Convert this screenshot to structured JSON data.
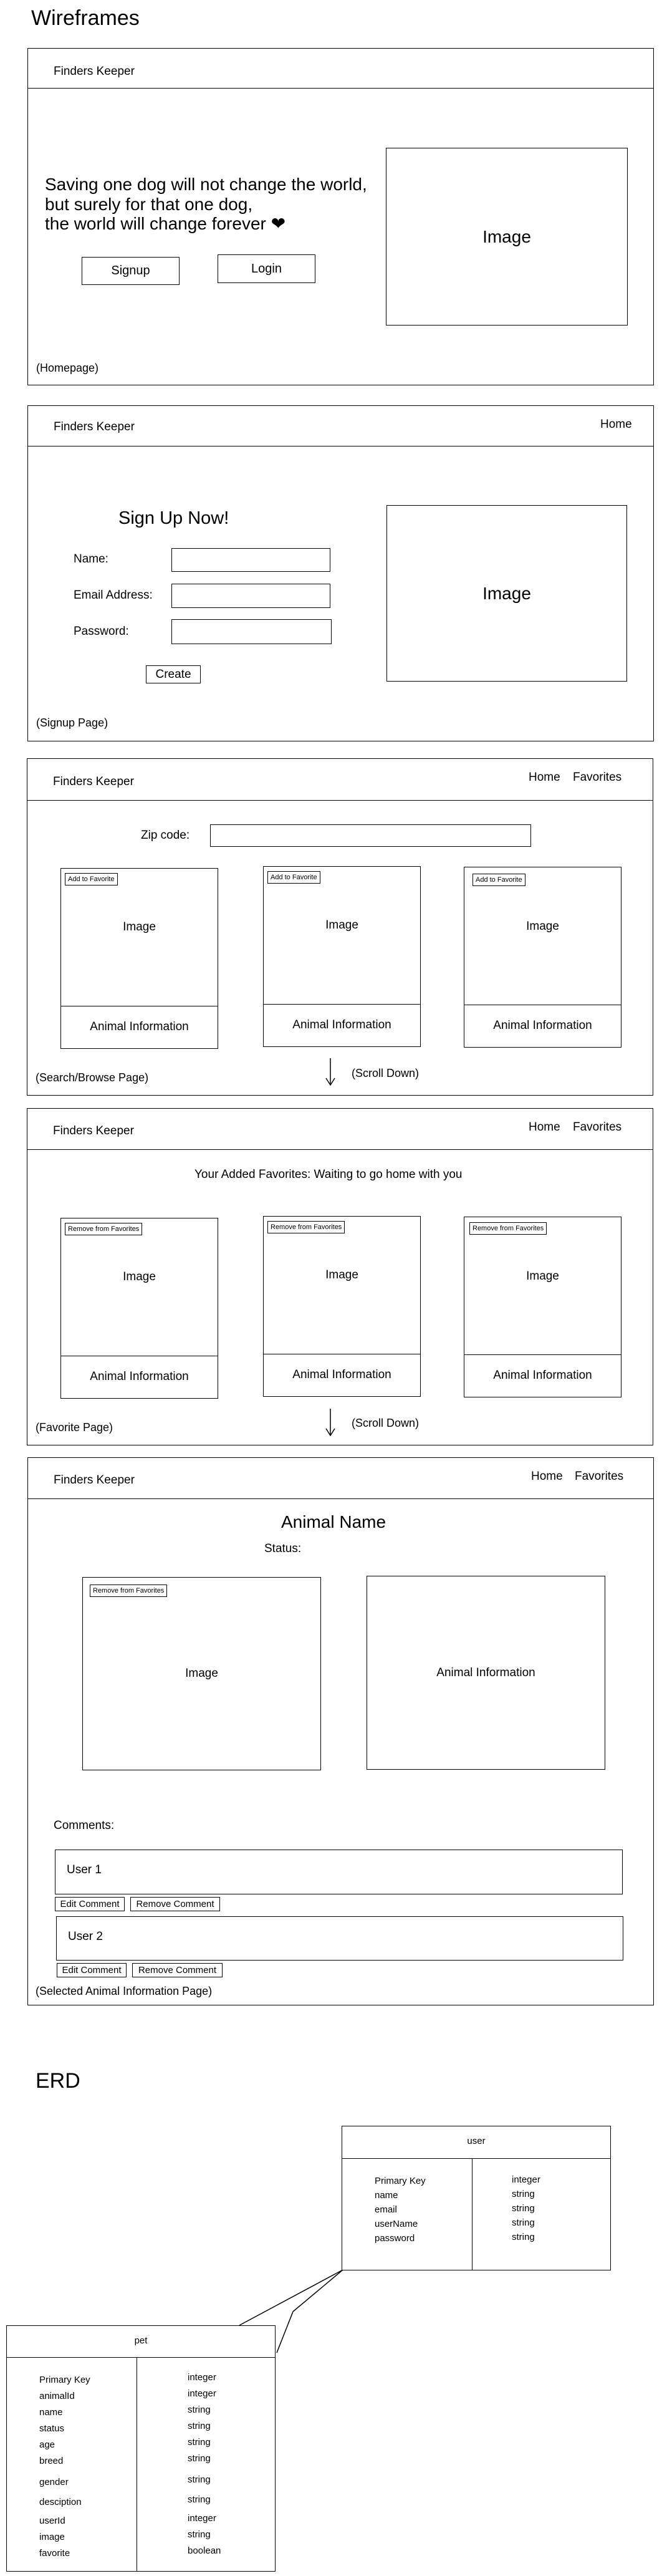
{
  "page_title": "Wireframes",
  "brand": "Finders Keeper",
  "nav": {
    "home": "Home",
    "favorites": "Favorites"
  },
  "image_label": "Image",
  "animal_info_label": "Animal Information",
  "scroll_down_label": "(Scroll Down)",
  "homepage": {
    "quote_line1": "Saving one dog will not change the world,",
    "quote_line2": "but surely for that one dog,",
    "quote_line3": "the world will change forever ❤",
    "signup_button": "Signup",
    "login_button": "Login",
    "caption": "(Homepage)"
  },
  "signup": {
    "heading": "Sign Up Now!",
    "name_label": "Name:",
    "email_label": "Email Address:",
    "password_label": "Password:",
    "create_button": "Create",
    "caption": "(Signup Page)"
  },
  "search": {
    "zip_label": "Zip code:",
    "add_favorite": "Add to Favorite",
    "caption": "(Search/Browse Page)"
  },
  "favorites": {
    "heading": "Your Added Favorites: Waiting to go home with you",
    "remove_favorite": "Remove from Favorites",
    "caption": "(Favorite Page)"
  },
  "selected": {
    "animal_name": "Animal Name",
    "status": "Status:",
    "remove_favorite": "Remove from Favorites",
    "comments_label": "Comments:",
    "user1": "User 1",
    "user2": "User 2",
    "edit_comment": "Edit Comment",
    "remove_comment": "Remove Comment",
    "caption": "(Selected Animal Information Page)"
  },
  "erd": {
    "title": "ERD",
    "user_table": {
      "name": "user",
      "fields": [
        "Primary Key",
        "name",
        "email",
        "userName",
        "password"
      ],
      "types": [
        "integer",
        "string",
        "string",
        "string",
        "string"
      ]
    },
    "pet_table": {
      "name": "pet",
      "fields": [
        "Primary Key",
        "animalId",
        "name",
        "status",
        "age",
        "breed",
        "gender",
        "desciption",
        "userId",
        "image",
        "favorite"
      ],
      "types": [
        "integer",
        "integer",
        "string",
        "string",
        "string",
        "string",
        "string",
        "string",
        "integer",
        "string",
        "boolean"
      ]
    }
  }
}
